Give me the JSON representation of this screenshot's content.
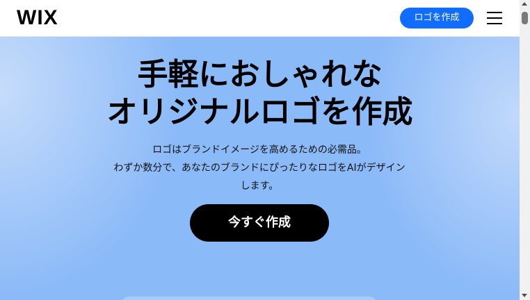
{
  "header": {
    "logo": "WIX",
    "cta_label": "ロゴを作成",
    "menu_icon": "hamburger-menu-icon"
  },
  "hero": {
    "headline_line1": "手軽におしゃれな",
    "headline_line2": "オリジナルロゴを作成",
    "subtext_line1": "ロゴはブランドイメージを高めるための必需品。",
    "subtext_line2": "わずか数分で、あなたのブランドにぴったりなロゴをAIがデザイン",
    "subtext_line3": "します。",
    "cta_label": "今すぐ作成"
  },
  "colors": {
    "brand_blue": "#116dff",
    "hero_background": "#8bbaf8",
    "cta_background": "#000000"
  }
}
